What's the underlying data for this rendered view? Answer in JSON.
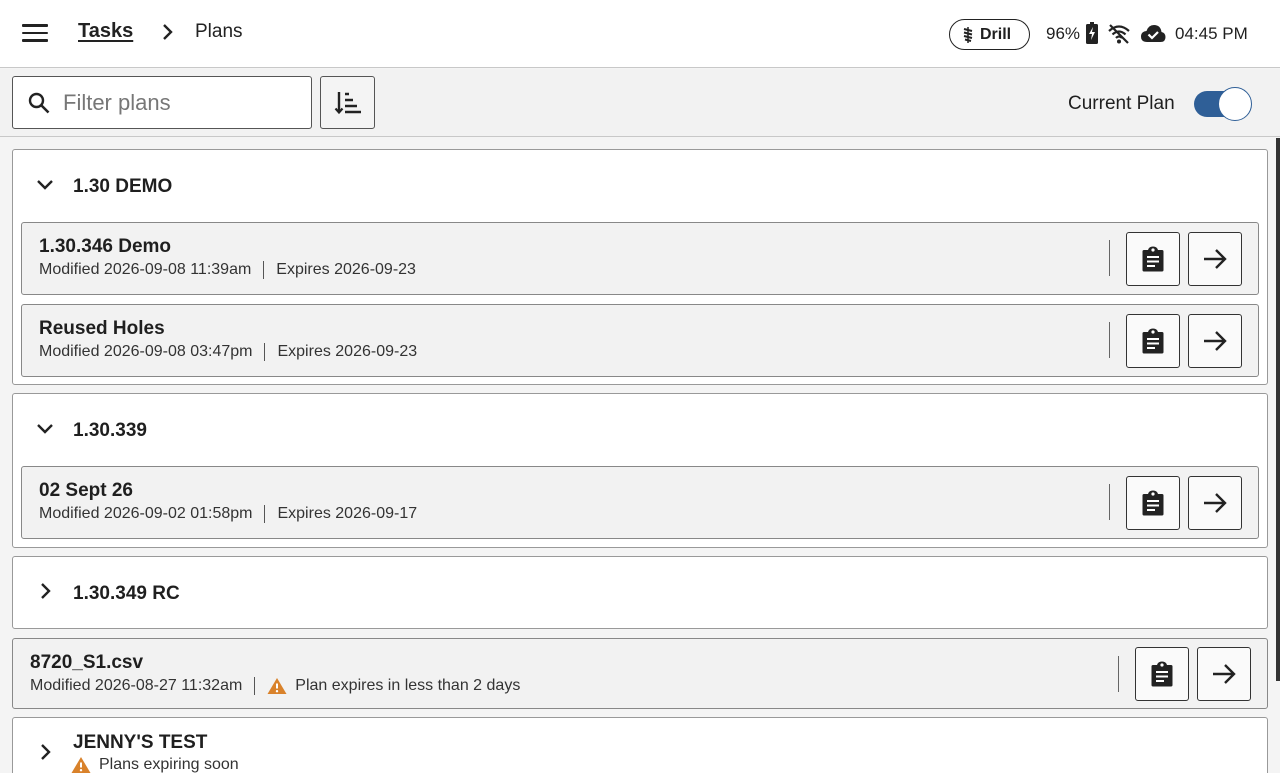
{
  "header": {
    "breadcrumb_parent": "Tasks",
    "breadcrumb_current": "Plans",
    "mode_label": "Drill",
    "battery": "96%",
    "time": "04:45 PM"
  },
  "toolbar": {
    "filter_placeholder": "Filter plans",
    "filter_value": "",
    "current_plan_label": "Current Plan",
    "current_plan_enabled": true
  },
  "groups": [
    {
      "title": "1.30 DEMO",
      "expanded": true,
      "plans": [
        {
          "name": "1.30.346 Demo",
          "modified": "Modified 2026-09-08 11:39am",
          "expires": "Expires 2026-09-23"
        },
        {
          "name": "Reused Holes",
          "modified": "Modified 2026-09-08 03:47pm",
          "expires": "Expires 2026-09-23"
        }
      ]
    },
    {
      "title": "1.30.339",
      "expanded": true,
      "plans": [
        {
          "name": "02 Sept 26",
          "modified": "Modified 2026-09-02 01:58pm",
          "expires": "Expires 2026-09-17"
        }
      ]
    },
    {
      "title": "1.30.349 RC",
      "expanded": false,
      "plans": []
    }
  ],
  "standalone_plan": {
    "name": "8720_S1.csv",
    "modified": "Modified 2026-08-27 11:32am",
    "warning": "Plan expires in less than 2 days"
  },
  "last_group": {
    "title": "JENNY'S TEST",
    "warning": "Plans expiring soon",
    "expanded": false
  },
  "colors": {
    "accent": "#2f5f97",
    "warning": "#d9822b"
  }
}
